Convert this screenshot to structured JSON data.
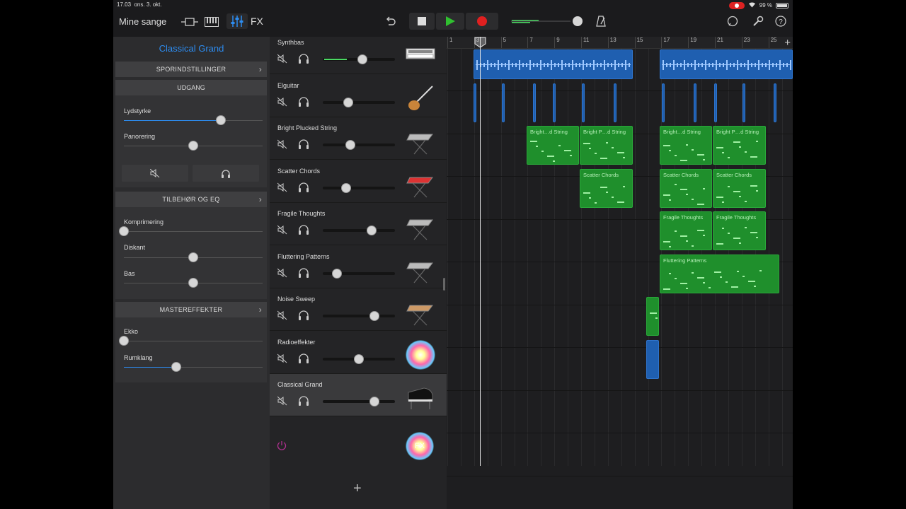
{
  "status": {
    "time": "17.03",
    "date": "ons. 3. okt.",
    "battery": "99 %"
  },
  "toolbar": {
    "my_songs": "Mine sange",
    "fx": "FX"
  },
  "sidebar": {
    "title": "Classical Grand",
    "sections": {
      "track_settings": "SPORINDSTILLINGER",
      "output": "UDGANG",
      "plugins_eq": "TILBEHØR OG EQ",
      "master_effects": "MASTEREFFEKTER"
    },
    "labels": {
      "volume": "Lydstyrke",
      "pan": "Panorering",
      "compression": "Komprimering",
      "treble": "Diskant",
      "bass": "Bas",
      "echo": "Ekko",
      "reverb": "Rumklang"
    },
    "levels": {
      "volume": 0.7,
      "pan": 0.5,
      "compression": 0.0,
      "treble": 0.5,
      "bass": 0.5,
      "echo": 0.0,
      "reverb": 0.38
    }
  },
  "tracks": [
    {
      "name": "Synthbas",
      "level": 0.55,
      "instrument": "synth-keyboard-icon"
    },
    {
      "name": "Elguitar",
      "level": 0.35,
      "instrument": "electric-guitar-icon"
    },
    {
      "name": "Bright Plucked String",
      "level": 0.38,
      "instrument": "keyboard-stand-icon"
    },
    {
      "name": "Scatter Chords",
      "level": 0.32,
      "instrument": "red-keyboard-icon"
    },
    {
      "name": "Fragile Thoughts",
      "level": 0.68,
      "instrument": "keyboard-stand-icon"
    },
    {
      "name": "Fluttering Patterns",
      "level": 0.2,
      "instrument": "keyboard-stand-icon"
    },
    {
      "name": "Noise Sweep",
      "level": 0.72,
      "instrument": "analog-synth-icon"
    },
    {
      "name": "Radioeffekter",
      "level": 0.5,
      "instrument": "sparkle-fx-icon"
    },
    {
      "name": "Classical Grand",
      "level": 0.72,
      "instrument": "grand-piano-icon"
    }
  ],
  "master_fx_label": "FX",
  "ruler": {
    "bars": [
      "1",
      "3",
      "5",
      "7",
      "9",
      "11",
      "13",
      "15",
      "17",
      "19",
      "21",
      "23",
      "25"
    ]
  },
  "regions": {
    "bright1": "Bright…d String",
    "bright2": "Bright P…d String",
    "bright3": "Bright…d String",
    "bright4": "Bright P…d String",
    "scatter1": "Scatter Chords",
    "scatter2": "Scatter Chords",
    "scatter3": "Scatter Chords",
    "fragile1": "Fragile Thoughts",
    "fragile2": "Fragile Thoughts",
    "flutter1": "Fluttering Patterns"
  },
  "colors": {
    "accent": "#2d8cf0",
    "play": "#30c030",
    "record": "#e02020",
    "audio_region": "#1f5fb0",
    "midi_region": "#1f8f2c"
  }
}
